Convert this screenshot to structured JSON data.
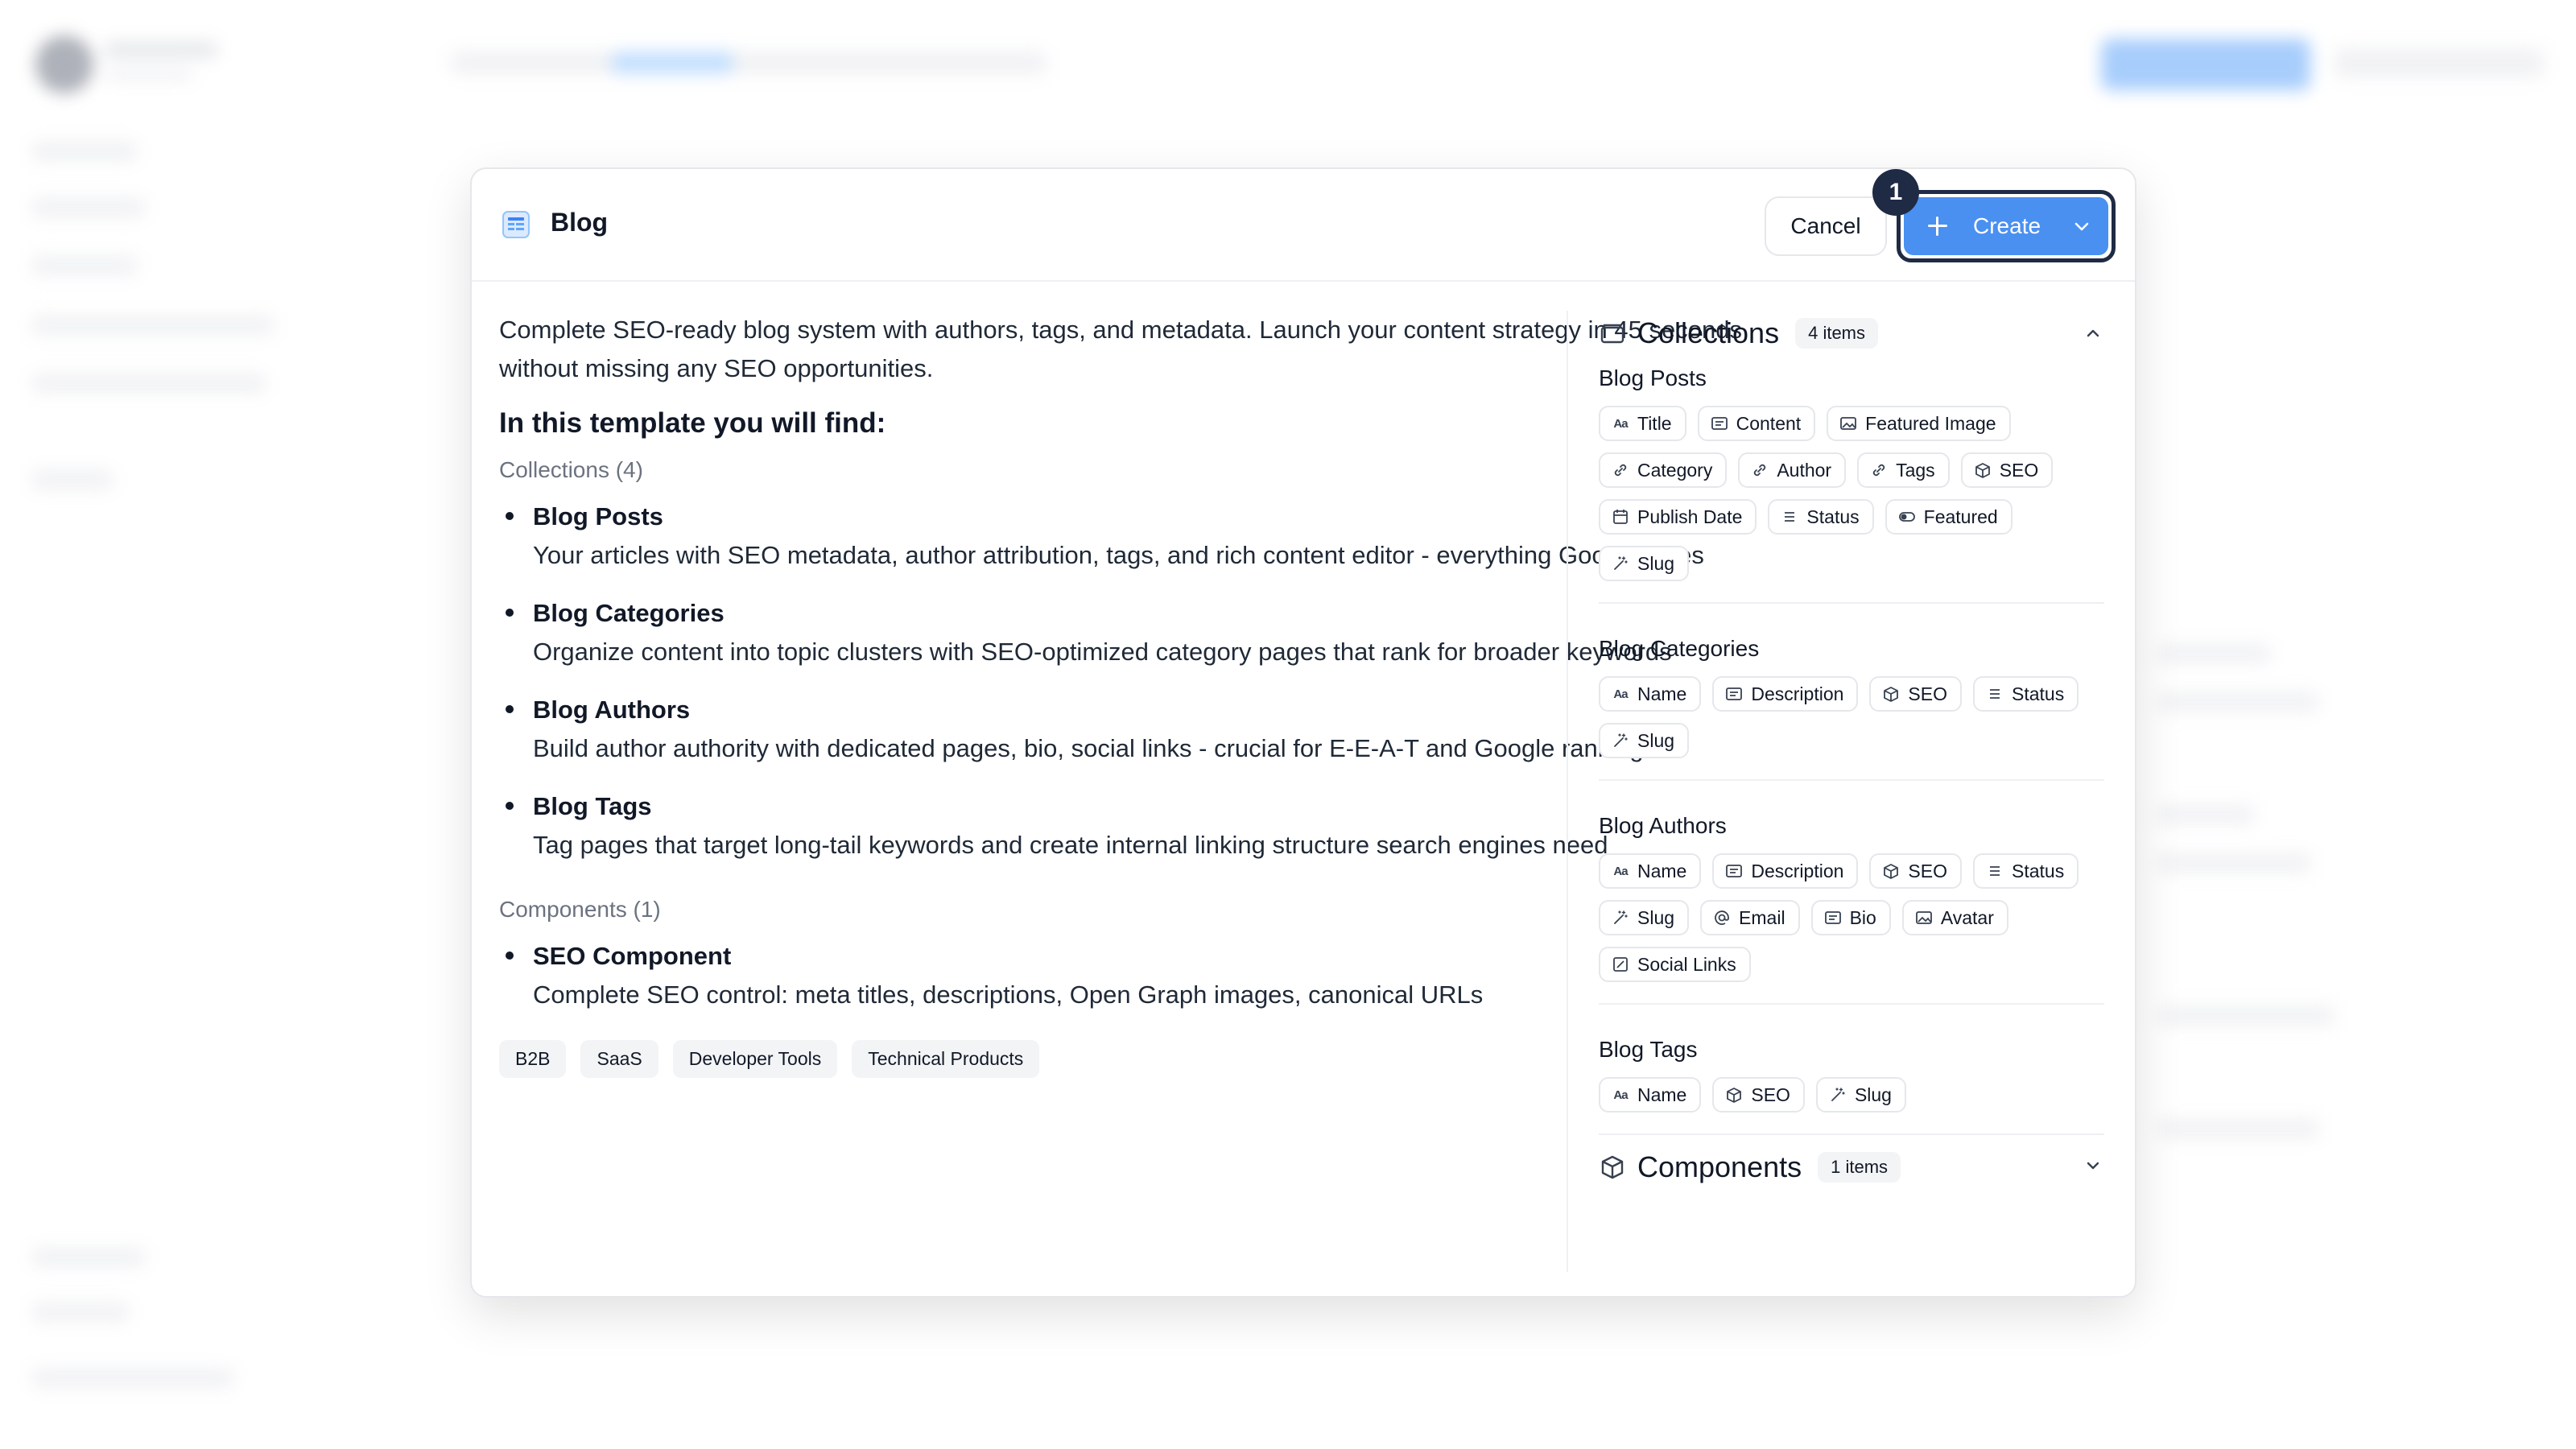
{
  "modal": {
    "title": "Blog",
    "cancel_label": "Cancel",
    "create_label": "Create",
    "step_badge": "1"
  },
  "description": "Complete SEO-ready blog system with authors, tags, and metadata. Launch your content strategy in 45 seconds without missing any SEO opportunities.",
  "find_heading": "In this template you will find:",
  "collections_label": "Collections (4)",
  "collections": [
    {
      "title": "Blog Posts",
      "desc": "Your articles with SEO metadata, author attribution, tags, and rich content editor - everything Google loves"
    },
    {
      "title": "Blog Categories",
      "desc": "Organize content into topic clusters with SEO-optimized category pages that rank for broader keywords"
    },
    {
      "title": "Blog Authors",
      "desc": "Build author authority with dedicated pages, bio, social links - crucial for E-E-A-T and Google rankings"
    },
    {
      "title": "Blog Tags",
      "desc": "Tag pages that target long-tail keywords and create internal linking structure search engines need"
    }
  ],
  "components_label": "Components (1)",
  "components": [
    {
      "title": "SEO Component",
      "desc": "Complete SEO control: meta titles, descriptions, Open Graph images, canonical URLs"
    }
  ],
  "tags": [
    "B2B",
    "SaaS",
    "Developer Tools",
    "Technical Products"
  ],
  "panel": {
    "collections_title": "Collections",
    "collections_count": "4 items",
    "components_title": "Components",
    "components_count": "1 items",
    "groups": [
      {
        "title": "Blog Posts",
        "fields": [
          {
            "icon": "text-icon",
            "label": "Title"
          },
          {
            "icon": "richtext-icon",
            "label": "Content"
          },
          {
            "icon": "image-icon",
            "label": "Featured Image"
          },
          {
            "icon": "link-icon",
            "label": "Category"
          },
          {
            "icon": "link-icon",
            "label": "Author"
          },
          {
            "icon": "link-icon",
            "label": "Tags"
          },
          {
            "icon": "component-icon",
            "label": "SEO"
          },
          {
            "icon": "calendar-icon",
            "label": "Publish Date"
          },
          {
            "icon": "list-icon",
            "label": "Status"
          },
          {
            "icon": "toggle-icon",
            "label": "Featured"
          },
          {
            "icon": "magic-wand-icon",
            "label": "Slug"
          }
        ]
      },
      {
        "title": "Blog Categories",
        "fields": [
          {
            "icon": "text-icon",
            "label": "Name"
          },
          {
            "icon": "richtext-icon",
            "label": "Description"
          },
          {
            "icon": "component-icon",
            "label": "SEO"
          },
          {
            "icon": "list-icon",
            "label": "Status"
          },
          {
            "icon": "magic-wand-icon",
            "label": "Slug"
          }
        ]
      },
      {
        "title": "Blog Authors",
        "fields": [
          {
            "icon": "text-icon",
            "label": "Name"
          },
          {
            "icon": "richtext-icon",
            "label": "Description"
          },
          {
            "icon": "component-icon",
            "label": "SEO"
          },
          {
            "icon": "list-icon",
            "label": "Status"
          },
          {
            "icon": "magic-wand-icon",
            "label": "Slug"
          },
          {
            "icon": "at-icon",
            "label": "Email"
          },
          {
            "icon": "richtext-icon",
            "label": "Bio"
          },
          {
            "icon": "image-icon",
            "label": "Avatar"
          },
          {
            "icon": "json-icon",
            "label": "Social Links"
          }
        ]
      },
      {
        "title": "Blog Tags",
        "fields": [
          {
            "icon": "text-icon",
            "label": "Name"
          },
          {
            "icon": "component-icon",
            "label": "SEO"
          },
          {
            "icon": "magic-wand-icon",
            "label": "Slug"
          }
        ]
      }
    ]
  },
  "colors": {
    "accent": "#4a90f0",
    "badge": "#1f2a44"
  }
}
